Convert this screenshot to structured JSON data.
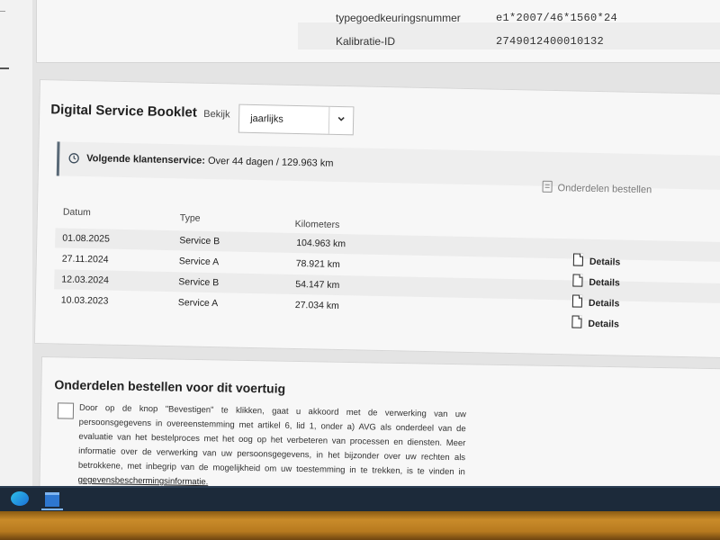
{
  "vehicle_info": {
    "rows": [
      {
        "label": "typegoedkeuringsnummer",
        "value": "e1*2007/46*1560*24"
      },
      {
        "label": "Kalibratie-ID",
        "value": "2749012400010132"
      }
    ]
  },
  "booklet": {
    "title": "Digital Service Booklet",
    "view_label": "Bekijk",
    "view_value": "jaarlijks",
    "next_service_label": "Volgende klantenservice:",
    "next_service_value": "Over 44 dagen / 129.963 km",
    "order_parts_link": "Onderdelen bestellen",
    "columns": [
      "Datum",
      "Type",
      "Kilometers"
    ],
    "rows": [
      {
        "date": "01.08.2025",
        "type": "Service B",
        "km": "104.963 km"
      },
      {
        "date": "27.11.2024",
        "type": "Service A",
        "km": "78.921 km"
      },
      {
        "date": "12.03.2024",
        "type": "Service B",
        "km": "54.147 km"
      },
      {
        "date": "10.03.2023",
        "type": "Service A",
        "km": "27.034 km"
      }
    ],
    "details_label": "Details"
  },
  "order_section": {
    "title": "Onderdelen bestellen voor dit voertuig",
    "consent_text": "Door op de knop \"Bevestigen\" te klikken, gaat u akkoord met de verwerking van uw persoonsgegevens in overeenstemming met artikel 6, lid 1, onder a) AVG als onderdeel van de evaluatie van het bestelproces met het oog op het verbeteren van processen en diensten. Meer informatie over de verwerking van uw persoonsgegevens, in het bijzonder over uw rechten als betrokkene, met inbegrip van de mogelijkheid om uw toestemming in te trekken, is te vinden in",
    "privacy_link": "gegevensbeschermingsinformatie."
  },
  "icons": {
    "clock": "clock-icon",
    "parts": "parts-document-icon",
    "details": "document-icon",
    "chevron": "chevron-down-icon",
    "windows": "windows-start-icon"
  },
  "colors": {
    "accent_border": "#5a6a78",
    "taskbar": "#1c2a3a"
  }
}
